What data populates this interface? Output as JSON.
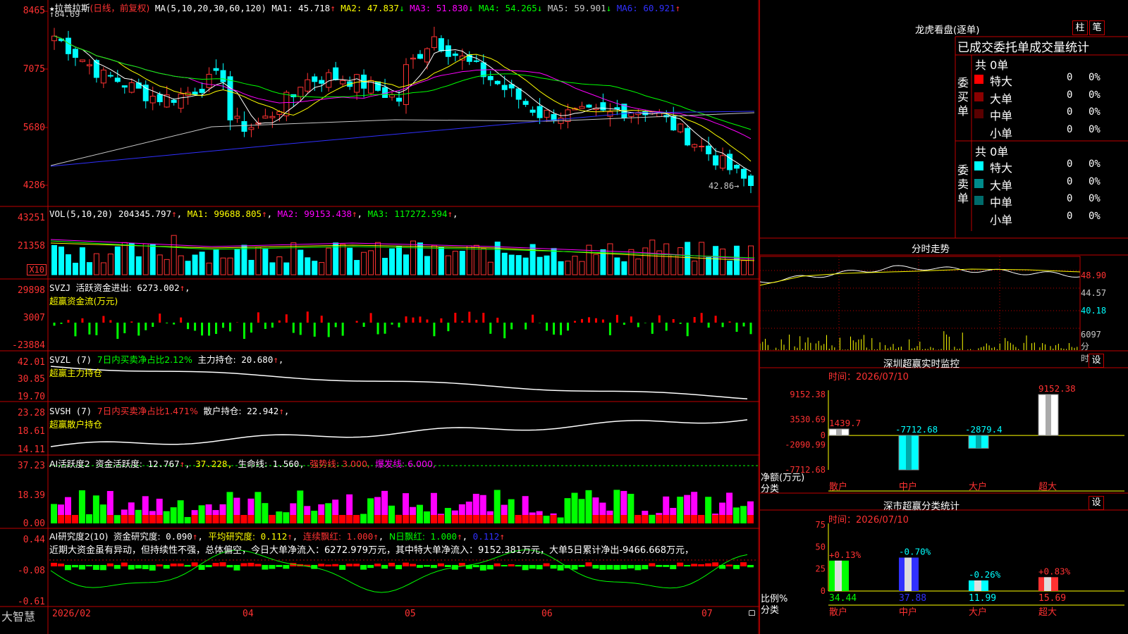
{
  "colors": {
    "up": "#ff3232",
    "down": "#00ffff",
    "green": "#00ff00",
    "red": "#ff0000",
    "yellow": "#ffff00",
    "magenta": "#ff00ff",
    "white": "#ffffff",
    "blue": "#3030ff",
    "axis": "#c00000"
  },
  "stock": {
    "star": "★",
    "name": "拉普拉斯",
    "mode": "(日线，前复权)",
    "ma_params": "MA(5,10,20,30,60,120)",
    "ma": [
      {
        "label": "MA1:",
        "value": "45.718",
        "arrow": "↑",
        "color": "#ffffff"
      },
      {
        "label": "MA2:",
        "value": "47.837",
        "arrow": "↓",
        "color": "#ffff00"
      },
      {
        "label": "MA3:",
        "value": "51.830",
        "arrow": "↓",
        "color": "#ff00ff"
      },
      {
        "label": "MA4:",
        "value": "54.265",
        "arrow": "↓",
        "color": "#00ff00"
      },
      {
        "label": "MA5:",
        "value": "59.901",
        "arrow": "↓",
        "color": "#c8c8c8"
      },
      {
        "label": "MA6:",
        "value": "60.921",
        "arrow": "↑",
        "color": "#3030ff"
      }
    ],
    "high_mark": "84.69",
    "low_mark": "42.86"
  },
  "price_axis": [
    "8465",
    "7075",
    "5680",
    "4286"
  ],
  "vol": {
    "params": "VOL(5,10,20)",
    "value": "204345.797",
    "ma": [
      {
        "label": "MA1:",
        "value": "99688.805",
        "color": "#ffff00"
      },
      {
        "label": "MA2:",
        "value": "99153.438",
        "color": "#ff00ff"
      },
      {
        "label": "MA3:",
        "value": "117272.594",
        "color": "#00ff00"
      }
    ],
    "axis": [
      "43251",
      "21358"
    ],
    "unit": "X10"
  },
  "svzj": {
    "title": "SVZJ",
    "label": "活跃资金进出:",
    "value": "6273.002",
    "sub": "超赢资金流(万元)",
    "axis": [
      "29898",
      "3007",
      "-23884"
    ]
  },
  "svzl": {
    "title": "SVZL (7)",
    "ratio": "7日内买卖净占比2.12%",
    "label": "主力持仓:",
    "value": "20.680",
    "sub": "超赢主力持仓",
    "axis": [
      "42.01",
      "30.85",
      "19.70"
    ]
  },
  "svsh": {
    "title": "SVSH (7)",
    "ratio": "7日内买卖净占比1.471%",
    "label": "散户持仓:",
    "value": "22.942",
    "sub": "超赢散户持仓",
    "axis": [
      "23.28",
      "18.61",
      "14.11"
    ]
  },
  "ai1": {
    "title": "AI活跃度2",
    "l1": "资金活跃度:",
    "v1": "12.767",
    "v2": "37.228",
    "l3": "生命线:",
    "v3": "1.560",
    "l4": "强势线:",
    "v4": "3.000",
    "l5": "爆发线:",
    "v5": "6.000",
    "axis": [
      "37.23",
      "18.39",
      "0.00"
    ]
  },
  "ai2": {
    "title": "AI研究度2(10)",
    "l1": "资金研究度:",
    "v1": "0.090",
    "l2": "平均研究度:",
    "v2": "0.112",
    "l3": "连续飘红:",
    "v3": "1.000",
    "l4": "N日飘红:",
    "v4": "1.000",
    "v5": "0.112",
    "text": "近期大资金虽有异动，但持续性不强，总体偏空，今日大单净流入：6272.979万元，其中特大单净流入：9152.381万元，大单5日累计净出-9466.668万元，",
    "axis": [
      "0.44",
      "-0.08",
      "-0.61"
    ]
  },
  "xaxis": [
    "2026/02",
    "04",
    "05",
    "06",
    "07"
  ],
  "brand": "大智慧",
  "right": {
    "lh_title": "龙虎看盘(逐单)",
    "btn1": "柱",
    "btn2": "笔",
    "tabs": "已成交委托单成交量统计",
    "buy": {
      "side": "委买单",
      "total": "共 0单",
      "rows": [
        {
          "name": "特大",
          "v": "0",
          "p": "0%",
          "c": "#ff0000"
        },
        {
          "name": "大单",
          "v": "0",
          "p": "0%",
          "c": "#8b0000"
        },
        {
          "name": "中单",
          "v": "0",
          "p": "0%",
          "c": "#5a0000"
        },
        {
          "name": "小单",
          "v": "0",
          "p": "0%",
          "c": "#000000"
        }
      ]
    },
    "sell": {
      "side": "委卖单",
      "total": "共 0单",
      "rows": [
        {
          "name": "特大",
          "v": "0",
          "p": "0%",
          "c": "#00ffff"
        },
        {
          "name": "大单",
          "v": "0",
          "p": "0%",
          "c": "#008b8b"
        },
        {
          "name": "中单",
          "v": "0",
          "p": "0%",
          "c": "#006b6b"
        },
        {
          "name": "小单",
          "v": "0",
          "p": "0%",
          "c": "#000000"
        }
      ]
    },
    "fs_title": "分时走势",
    "fs_axis": [
      "48.90",
      "44.57",
      "40.18",
      "6097",
      "分时"
    ],
    "mon_title": "深圳超赢实时监控",
    "set": "设",
    "mon_time": "时间：2026/07/10",
    "mon_axis": [
      "9152.38",
      "3530.69",
      "0",
      "-2090.99",
      "-7712.68"
    ],
    "mon_ylabel": "净额(万元)",
    "mon_xlabel": "分类",
    "mon_bars": [
      {
        "cat": "散户",
        "v": 1439.7,
        "label": "1439.7"
      },
      {
        "cat": "中户",
        "v": -7712.68,
        "label": "-7712.68"
      },
      {
        "cat": "大户",
        "v": -2879.4,
        "label": "-2879.4"
      },
      {
        "cat": "超大",
        "v": 9152.38,
        "label": "9152.38"
      }
    ],
    "cls_title": "深市超赢分类统计",
    "cls_time": "时间：2026/07/10",
    "cls_axis": [
      "75",
      "50",
      "25",
      "0"
    ],
    "cls_ylabel": "比例%",
    "cls_xlabel": "分类",
    "cls_bars": [
      {
        "cat": "散户",
        "v": 34.44,
        "label": "34.44",
        "chg": "+0.13%",
        "c": "#00ff00"
      },
      {
        "cat": "中户",
        "v": 37.88,
        "label": "37.88",
        "chg": "-0.70%",
        "c": "#3030ff"
      },
      {
        "cat": "大户",
        "v": 11.99,
        "label": "11.99",
        "chg": "-0.26%",
        "c": "#00ffff"
      },
      {
        "cat": "超大",
        "v": 15.69,
        "label": "15.69",
        "chg": "+0.83%",
        "c": "#ff3232"
      }
    ]
  }
}
